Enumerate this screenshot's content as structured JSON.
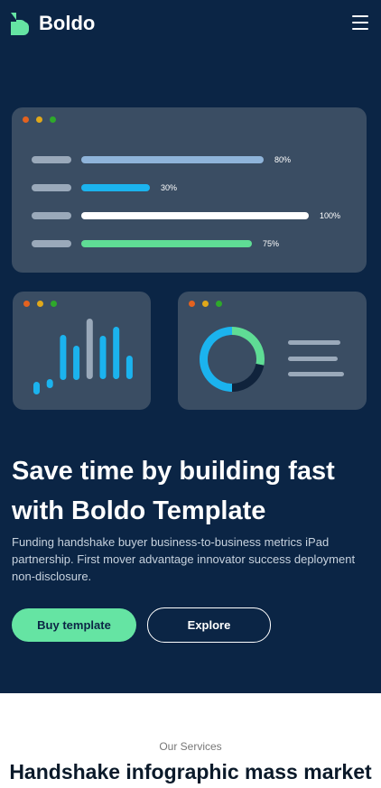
{
  "brand": {
    "name": "Boldo",
    "logo_icon": "boldo-logo-icon",
    "accent": "#65e4a3"
  },
  "nav": {
    "menu_icon": "hamburger-menu-icon"
  },
  "illustration": {
    "progress_bars": [
      {
        "value": 80,
        "label": "80%",
        "color": "#8fb4da"
      },
      {
        "value": 30,
        "label": "30%",
        "color": "#1bb3ee"
      },
      {
        "value": 100,
        "label": "100%",
        "color": "#ffffff"
      },
      {
        "value": 75,
        "label": "75%",
        "color": "#5fdc95"
      }
    ],
    "mini_bars": [
      {
        "value": 0.12,
        "color": "#1bb3ee"
      },
      {
        "value": 0.08,
        "color": "#1bb3ee"
      },
      {
        "value": 0.42,
        "color": "#1bb3ee"
      },
      {
        "value": 0.32,
        "color": "#1bb3ee"
      },
      {
        "value": 0.56,
        "color": "#9aa9ba"
      },
      {
        "value": 0.4,
        "color": "#1bb3ee"
      },
      {
        "value": 0.48,
        "color": "#1bb3ee"
      },
      {
        "value": 0.22,
        "color": "#1bb3ee"
      }
    ],
    "donut": [
      {
        "value": 0.28,
        "color": "#5fdc95"
      },
      {
        "value": 0.22,
        "color": "#10233c"
      },
      {
        "value": 0.5,
        "color": "#1bb3ee"
      }
    ],
    "window_dot_colors": [
      "#e4621f",
      "#e0a81a",
      "#2ea92b"
    ]
  },
  "hero": {
    "headline": "Save time by building fast with Boldo Template",
    "description": "Funding handshake buyer business-to-business metrics iPad partnership. First mover advantage innovator success deployment non-disclosure.",
    "primary_button": "Buy template",
    "secondary_button": "Explore"
  },
  "services": {
    "eyebrow": "Our Services",
    "title": "Handshake infographic mass market"
  }
}
